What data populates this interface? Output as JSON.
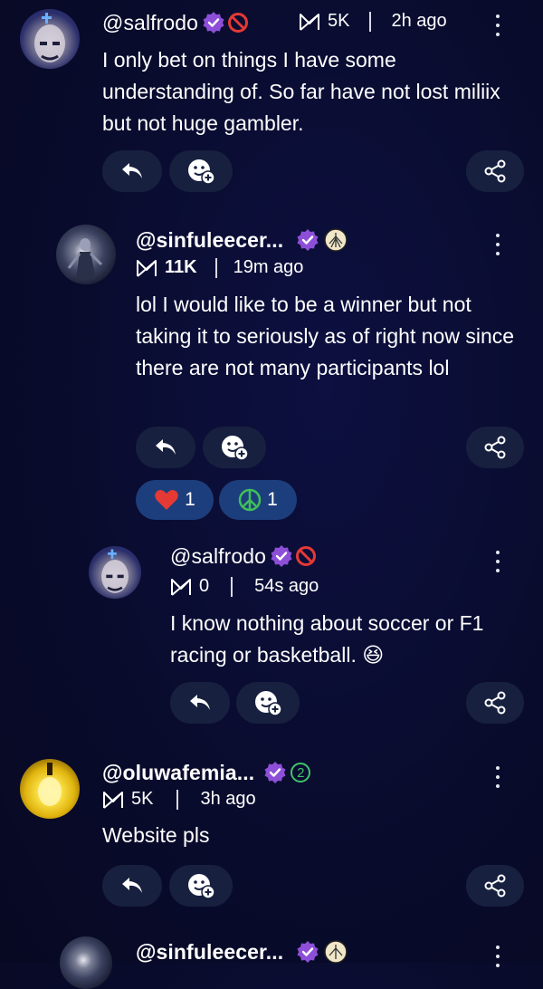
{
  "comments": [
    {
      "handle": "@salfrodo",
      "score": "5K",
      "time": "2h ago",
      "text": "I only bet on things I have some understanding of. So far have not lost miliix but not huge gambler."
    },
    {
      "handle": "@sinfuleecer...",
      "score": "11K",
      "time": "19m ago",
      "text": "lol I would like to be a winner but not taking it to seriously as of right now since there are not many participants lol",
      "reactions": [
        {
          "icon": "heart-icon",
          "count": "1"
        },
        {
          "icon": "peace-icon",
          "count": "1"
        }
      ]
    },
    {
      "handle": "@salfrodo",
      "score": "0",
      "time": "54s ago",
      "text": "I know nothing about soccer or F1 racing or basketball.",
      "emoji": "😆"
    },
    {
      "handle": "@oluwafemia...",
      "badge_number": "2",
      "score": "5K",
      "time": "3h ago",
      "text": "Website pls"
    },
    {
      "handle": "@sinfuleecer..."
    }
  ],
  "colors": {
    "background": "#090b2c",
    "pill": "#17203f",
    "reaction_pill": "#1d3e7c",
    "verified": "#8d4fd8",
    "ban": "#e53935",
    "number_badge": "#41c46a"
  }
}
